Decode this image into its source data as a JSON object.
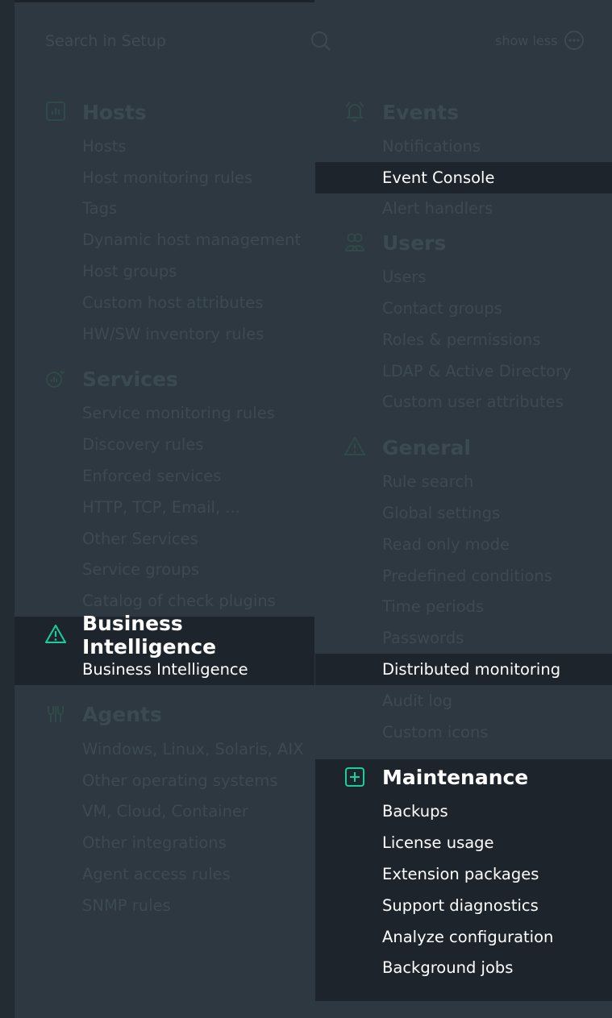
{
  "search": {
    "placeholder": "Search in Setup"
  },
  "header": {
    "show_less_label": "show less"
  },
  "left_column": {
    "hosts": {
      "title": "Hosts",
      "items": [
        "Hosts",
        "Host monitoring rules",
        "Tags",
        "Dynamic host management",
        "Host groups",
        "Custom host attributes",
        "HW/SW inventory rules"
      ]
    },
    "services": {
      "title": "Services",
      "items": [
        "Service monitoring rules",
        "Discovery rules",
        "Enforced services",
        "HTTP, TCP, Email, ...",
        "Other Services",
        "Service groups",
        "Catalog of check plugins"
      ]
    },
    "bi": {
      "title": "Business Intelligence",
      "items": [
        "Business Intelligence"
      ]
    },
    "agents": {
      "title": "Agents",
      "items": [
        "Windows, Linux, Solaris, AIX",
        "Other operating systems",
        "VM, Cloud, Container",
        "Other integrations",
        "Agent access rules",
        "SNMP rules"
      ]
    }
  },
  "right_column": {
    "events": {
      "title": "Events",
      "items": [
        "Notifications",
        "Event Console",
        "Alert handlers"
      ]
    },
    "users": {
      "title": "Users",
      "items": [
        "Users",
        "Contact groups",
        "Roles & permissions",
        "LDAP & Active Directory",
        "Custom user attributes"
      ]
    },
    "general": {
      "title": "General",
      "items": [
        "Rule search",
        "Global settings",
        "Read only mode",
        "Predefined conditions",
        "Time periods",
        "Passwords",
        "Distributed monitoring",
        "Audit log",
        "Custom icons"
      ]
    },
    "maintenance": {
      "title": "Maintenance",
      "items": [
        "Backups",
        "License usage",
        "Extension packages",
        "Support diagnostics",
        "Analyze configuration",
        "Background jobs"
      ]
    }
  },
  "colors": {
    "accent": "#15d1a0",
    "highlight_bg": "#1e242b",
    "dim_text": "#3c4a53"
  }
}
